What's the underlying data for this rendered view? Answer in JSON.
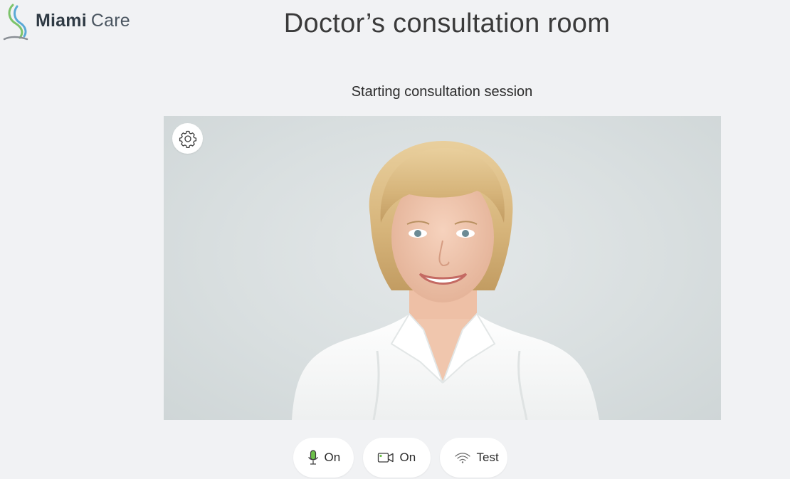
{
  "brand": {
    "name_bold": "Miami",
    "name_regular": "Care",
    "logo_icon": "miami-care-logo-icon"
  },
  "header": {
    "title": "Doctor’s consultation room"
  },
  "session": {
    "status": "Starting consultation session"
  },
  "video": {
    "settings_icon": "gear-icon"
  },
  "controls": {
    "mic": {
      "label": "On",
      "icon": "microphone-icon",
      "color": "#6cc04a"
    },
    "camera": {
      "label": "On",
      "icon": "video-camera-icon",
      "color": "#6cc04a"
    },
    "network": {
      "label": "Test",
      "icon": "wifi-signal-icon"
    }
  }
}
